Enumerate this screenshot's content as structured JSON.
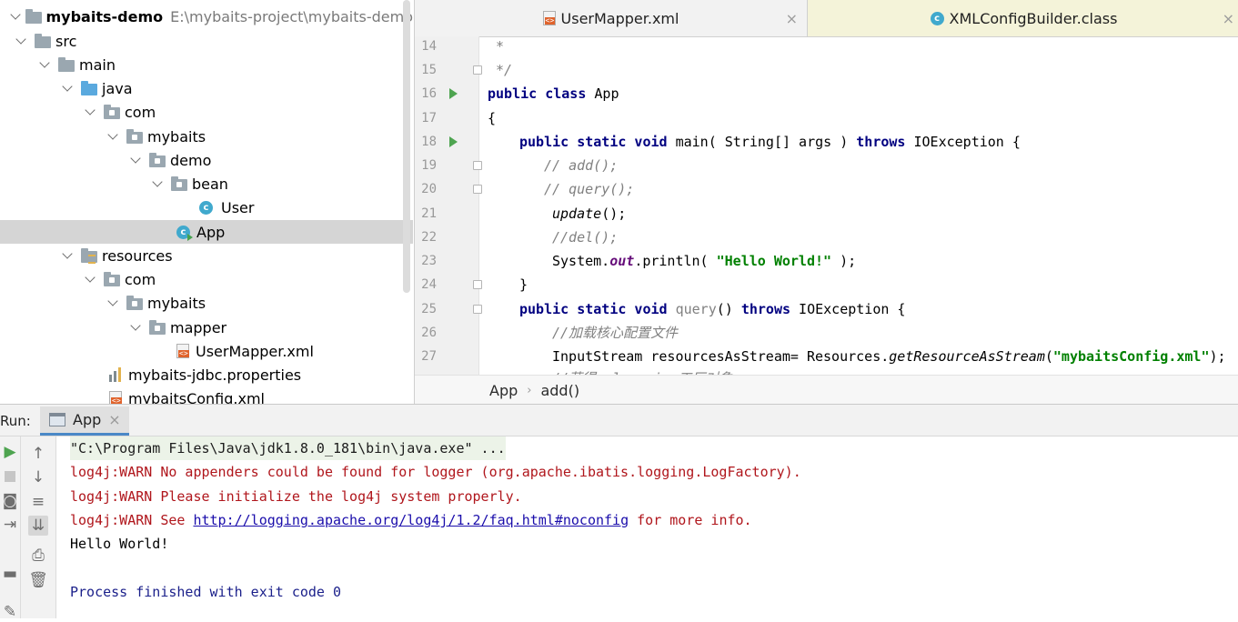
{
  "project": {
    "name": "mybaits-demo",
    "path": "E:\\mybaits-project\\mybaits-demo",
    "items": [
      {
        "label": "src"
      },
      {
        "label": "main"
      },
      {
        "label": "java"
      },
      {
        "label": "com"
      },
      {
        "label": "mybaits"
      },
      {
        "label": "demo"
      },
      {
        "label": "bean"
      },
      {
        "label": "User"
      },
      {
        "label": "App"
      },
      {
        "label": "resources"
      },
      {
        "label": "com"
      },
      {
        "label": "mybaits"
      },
      {
        "label": "mapper"
      },
      {
        "label": "UserMapper.xml"
      },
      {
        "label": "mybaits-jdbc.properties"
      },
      {
        "label": "mybaitsConfig.xml"
      }
    ]
  },
  "editor": {
    "tabs": [
      {
        "label": "UserMapper.xml",
        "close": "×"
      },
      {
        "label": "XMLConfigBuilder.class",
        "close": "×"
      }
    ],
    "line_numbers": [
      "14",
      "15",
      "16",
      "17",
      "18",
      "19",
      "20",
      "21",
      "22",
      "23",
      "24",
      "25",
      "26",
      "27"
    ],
    "code": {
      "l14": " *",
      "l15": " */",
      "l16_kw": "public class",
      "l16_name": " App",
      "l17": "{",
      "l18_kw": "public static void",
      "l18_a": " main( String[] args ) ",
      "l18_kw2": "throws",
      "l18_b": " IOException {",
      "l19": "// add();",
      "l20": "// query();",
      "l21_call": "update",
      "l21_rest": "();",
      "l22": "//del();",
      "l23_a": "System.",
      "l23_out": "out",
      "l23_b": ".println( ",
      "l23_str": "\"Hello World!\"",
      "l23_c": " );",
      "l24": "}",
      "l25_kw": "public static void",
      "l25_name": " query",
      "l25_a": "() ",
      "l25_kw2": "throws",
      "l25_b": " IOException {",
      "l26": "//加载核心配置文件",
      "l27_a": "InputStream resourcesAsStream= Resources.",
      "l27_call": "getResourceAsStream",
      "l27_b": "(",
      "l27_str": "\"mybaitsConfig.xml\"",
      "l27_c": ");",
      "l28_partial": "//获得sqlsession工厂对象"
    },
    "breadcrumb": [
      "App",
      "add()"
    ],
    "breadcrumb_sep": "›"
  },
  "run": {
    "label": "Run:",
    "tab": "App",
    "tab_close": "×",
    "console": {
      "cmd": "\"C:\\Program Files\\Java\\jdk1.8.0_181\\bin\\java.exe\" ...",
      "warn1": "log4j:WARN No appenders could be found for logger (org.apache.ibatis.logging.LogFactory).",
      "warn2": "log4j:WARN Please initialize the log4j system properly.",
      "warn3_a": "log4j:WARN See ",
      "warn3_link": "http://logging.apache.org/log4j/1.2/faq.html#noconfig",
      "warn3_b": " for more info.",
      "out": "Hello World!",
      "proc": "Process finished with exit code 0"
    },
    "toolbar": [
      "rerun-icon",
      "stop-icon",
      "camera-icon",
      "login-icon",
      "layout-icon",
      "up-arrow-icon",
      "down-arrow-icon",
      "soft-wrap-icon",
      "scroll-to-end-icon",
      "print-icon",
      "trash-icon",
      "pin-icon"
    ]
  },
  "colors": {
    "keyword": "#000080",
    "comment": "#808080",
    "string": "#008000",
    "field": "#660e7a",
    "warn": "#b0161c",
    "selection": "#d5d5d5",
    "run_green": "#4ea450"
  }
}
